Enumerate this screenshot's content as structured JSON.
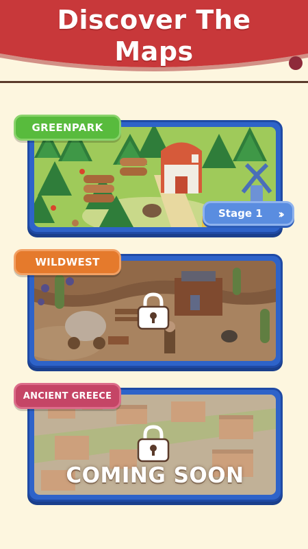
{
  "header": {
    "title_line1": "Discover The",
    "title_line2": "Maps",
    "color": "#c8383a"
  },
  "maps": [
    {
      "name": "GREENPARK",
      "tag_color": "#58bb3d",
      "locked": false,
      "stage_label": "Stage 1"
    },
    {
      "name": "WILDWEST",
      "tag_color": "#e57a2c",
      "locked": true
    },
    {
      "name": "ANCIENT GREECE",
      "tag_color": "#c54566",
      "locked": true,
      "status": "COMING SOON"
    }
  ],
  "icons": {
    "stage_arrow": "double-chevron-right-icon",
    "lock": "lock-icon"
  },
  "colors": {
    "background": "#fdf6df",
    "card_frame": "#2e63c9"
  }
}
